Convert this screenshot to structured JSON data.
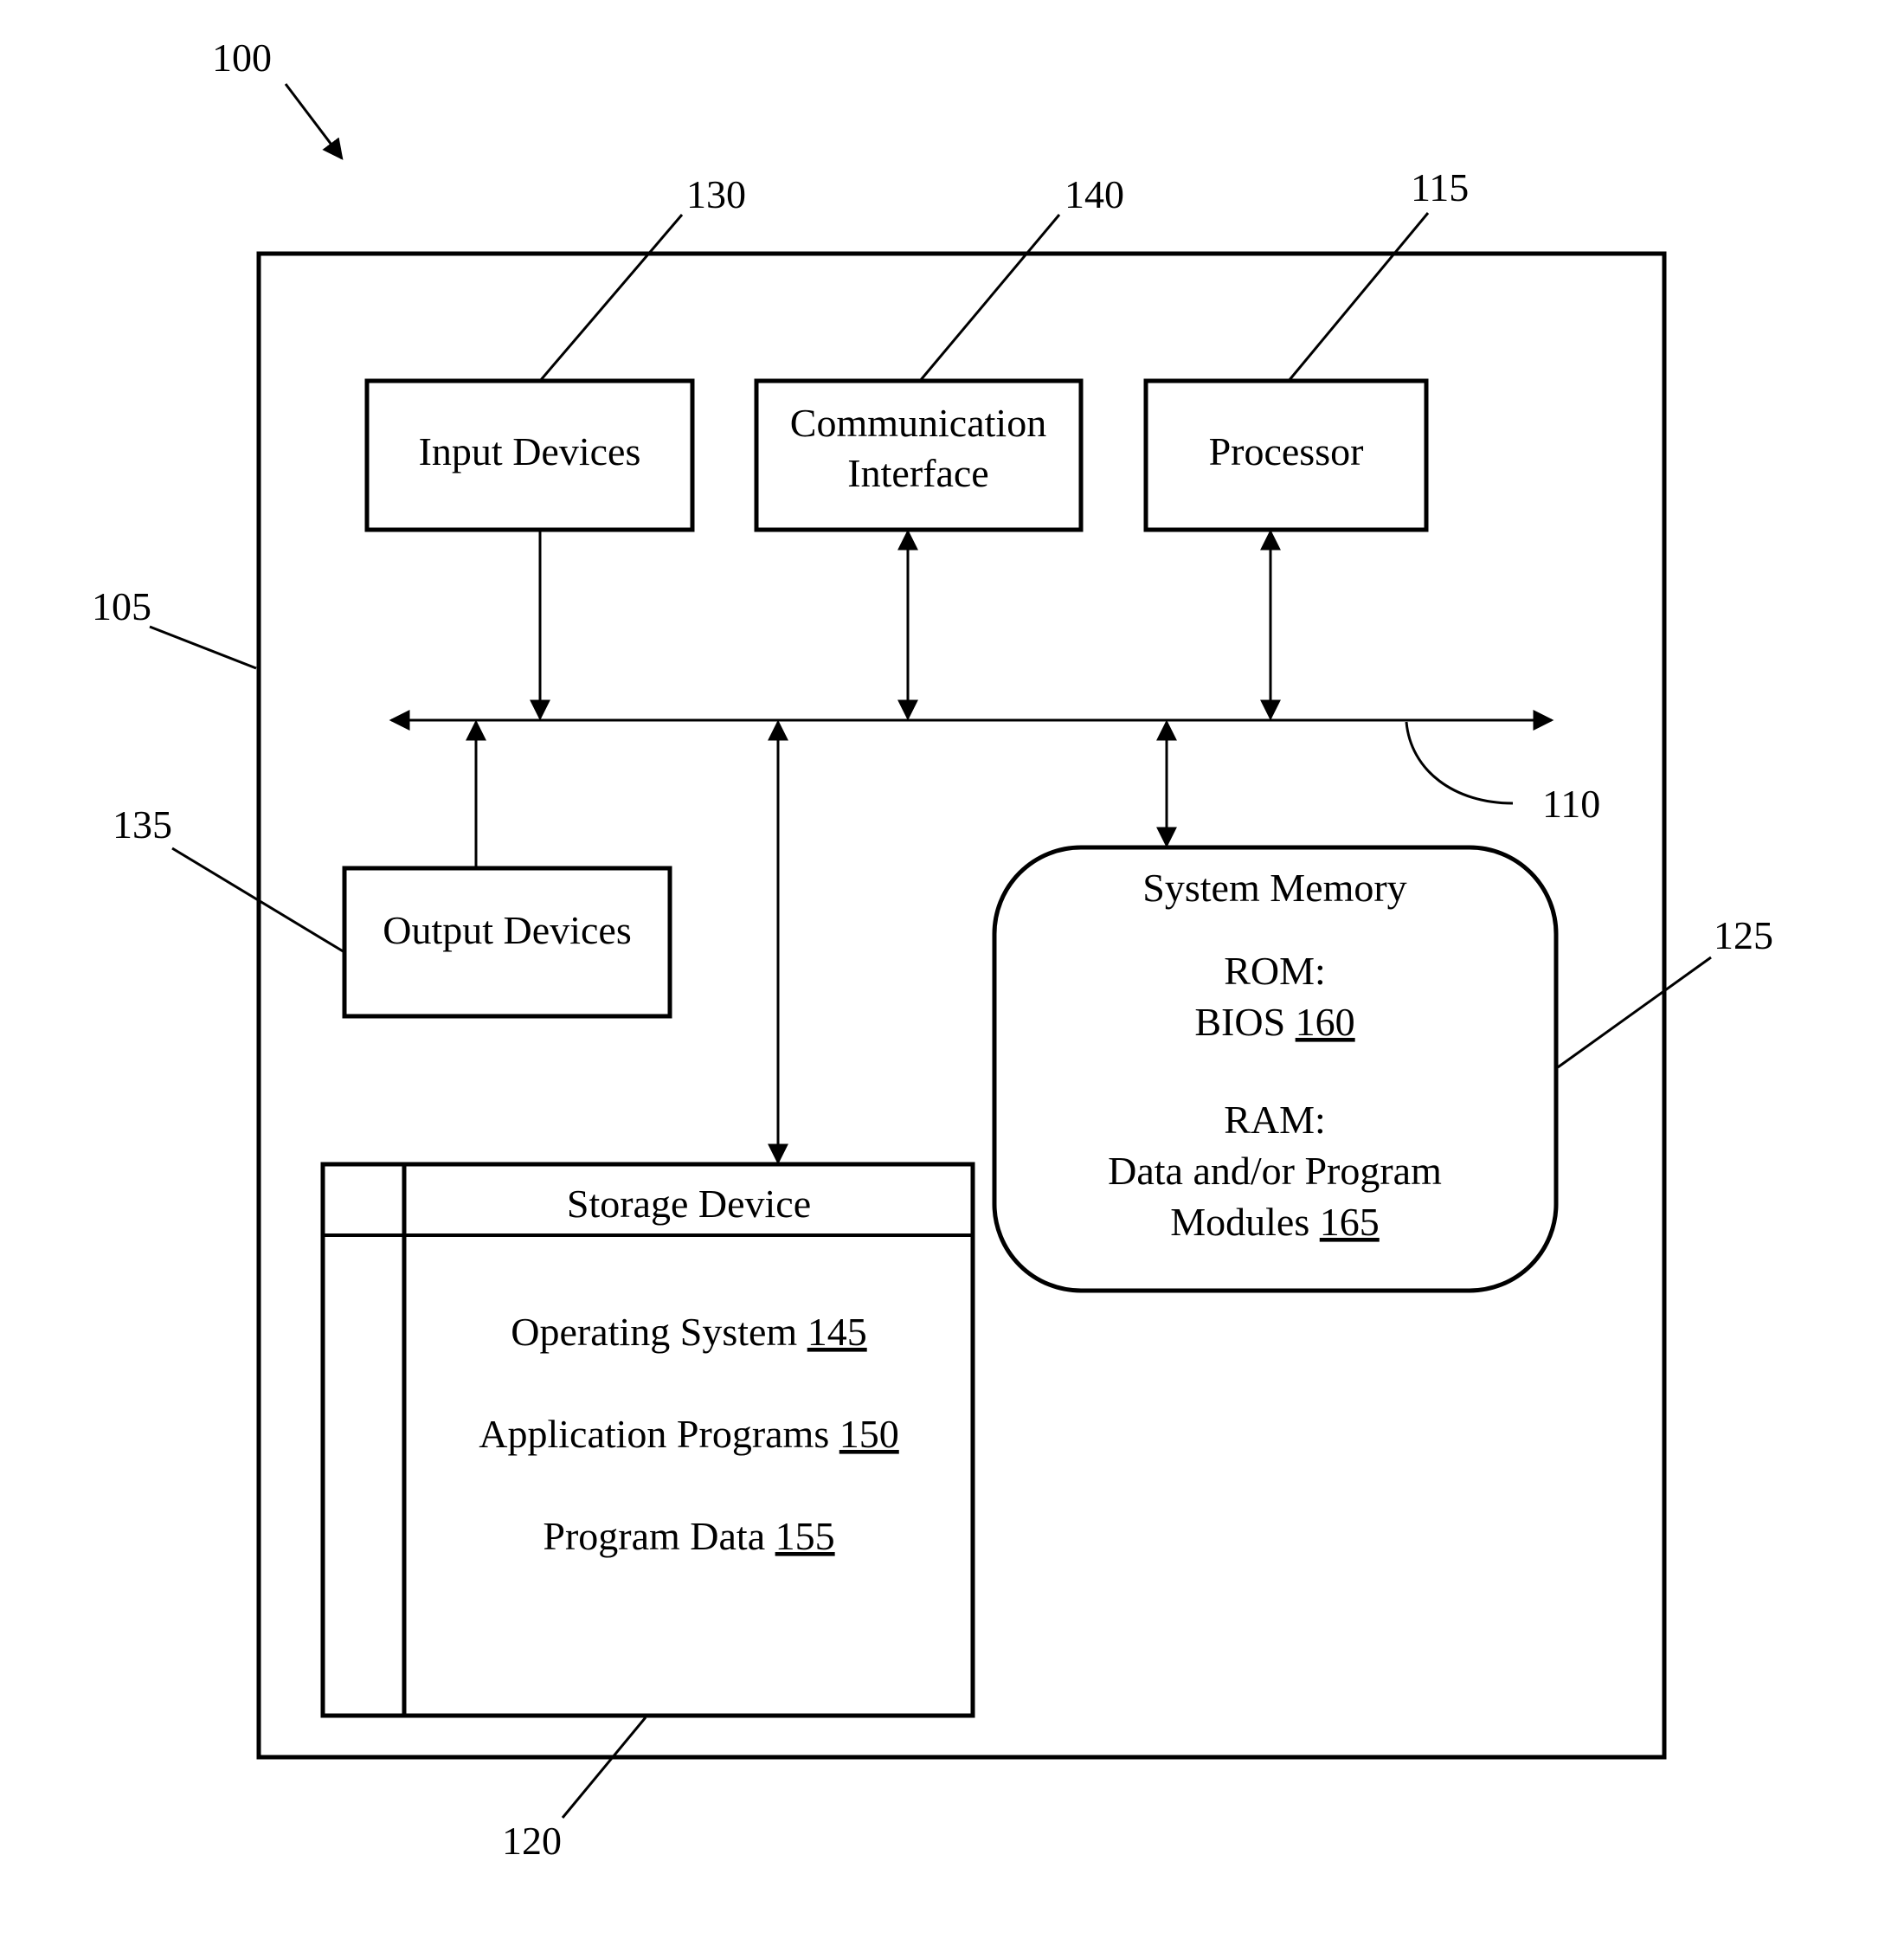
{
  "figure": {
    "figure_ref": "100",
    "system_ref": "105",
    "bus_ref": "110",
    "components": {
      "input_devices": {
        "label": "Input Devices",
        "ref": "130"
      },
      "communication_interface": {
        "label_lines": [
          "Communication",
          "Interface"
        ],
        "ref": "140"
      },
      "processor": {
        "label": "Processor",
        "ref": "115"
      },
      "output_devices": {
        "label": "Output Devices",
        "ref": "135"
      },
      "system_memory": {
        "title": "System Memory",
        "ref": "125",
        "rom_label": "ROM:",
        "bios_text": "BIOS ",
        "bios_ref": "160",
        "ram_label": "RAM:",
        "ram_line1": "Data and/or Program",
        "modules_text": "Modules ",
        "modules_ref": "165"
      },
      "storage_device": {
        "title": "Storage Device",
        "ref": "120",
        "items": [
          {
            "text": "Operating System ",
            "ref": "145"
          },
          {
            "text": "Application Programs ",
            "ref": "150"
          },
          {
            "text": "Program Data ",
            "ref": "155"
          }
        ]
      }
    }
  }
}
